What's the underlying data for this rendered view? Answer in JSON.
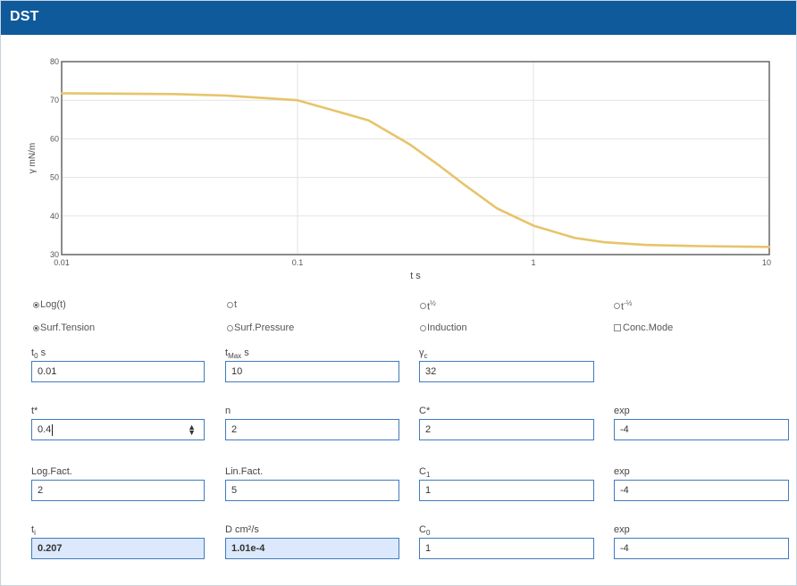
{
  "window": {
    "title": "DST"
  },
  "chart_data": {
    "type": "line",
    "xscale": "log",
    "xlim": [
      0.01,
      10
    ],
    "ylim": [
      30,
      80
    ],
    "x_ticks": [
      "0.01",
      "0.1",
      "1",
      "10"
    ],
    "y_ticks": [
      "30",
      "40",
      "50",
      "60",
      "70",
      "80"
    ],
    "xlabel": "t s",
    "ylabel": "γ mN/m",
    "grid": true,
    "series": [
      {
        "color": "#e8c36a",
        "x": [
          0.01,
          0.03,
          0.05,
          0.1,
          0.2,
          0.3,
          0.4,
          0.5,
          0.7,
          1,
          1.5,
          2,
          3,
          5,
          10
        ],
        "values": [
          71.8,
          71.6,
          71.2,
          70.0,
          64.8,
          58.5,
          53.0,
          48.5,
          42.0,
          37.5,
          34.3,
          33.2,
          32.5,
          32.2,
          32.0
        ]
      }
    ]
  },
  "options": {
    "row1": {
      "log_t": "Log(t)",
      "t": "t",
      "t_half_base": "t",
      "t_half_exp": "½",
      "t_minus_half_base": "t",
      "t_minus_half_exp": "-½"
    },
    "row2": {
      "surf_tension": "Surf.Tension",
      "surf_pressure": "Surf.Pressure",
      "induction": "Induction",
      "conc_mode": "Conc.Mode"
    }
  },
  "fields": {
    "t0": {
      "label_base": "t",
      "label_sub": "0",
      "label_unit": " s",
      "value": "0.01"
    },
    "tmax": {
      "label_base": "t",
      "label_sub": "Max",
      "label_unit": " s",
      "value": "10"
    },
    "gamma_c": {
      "label_base": "γ",
      "label_sub": "c",
      "value": "32"
    },
    "t_star": {
      "label": "t*",
      "value": "0.4"
    },
    "n": {
      "label": "n",
      "value": "2"
    },
    "c_star": {
      "label": "C*",
      "value": "2"
    },
    "exp1": {
      "label": "exp",
      "value": "-4"
    },
    "log_fact": {
      "label": "Log.Fact.",
      "value": "2"
    },
    "lin_fact": {
      "label": "Lin.Fact.",
      "value": "5"
    },
    "c1": {
      "label_base": "C",
      "label_sub": "1",
      "value": "1"
    },
    "exp2": {
      "label": "exp",
      "value": "-4"
    },
    "ti": {
      "label_base": "t",
      "label_sub": "i",
      "value": "0.207"
    },
    "d": {
      "label": "D cm²/s",
      "value": "1.01e-4"
    },
    "c0": {
      "label_base": "C",
      "label_sub": "0",
      "value": "1"
    },
    "exp3": {
      "label": "exp",
      "value": "-4"
    }
  }
}
